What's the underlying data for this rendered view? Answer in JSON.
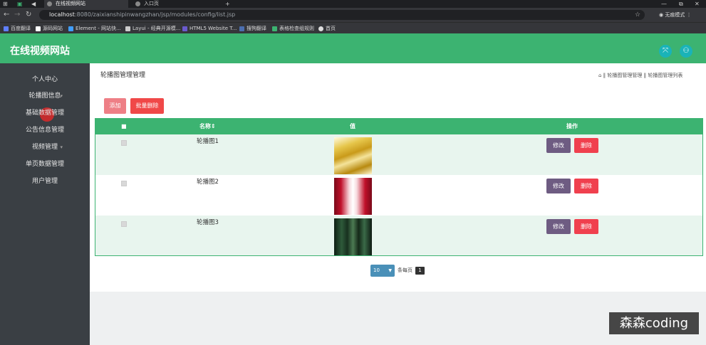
{
  "browser": {
    "tabs": [
      {
        "label": "在线视频网站"
      },
      {
        "label": "入口页"
      }
    ],
    "window_controls": {
      "minimize": "—",
      "restore": "⧉",
      "close": "✕"
    },
    "url_host": "localhost",
    "url_rest": ":8080/zaixianshipinwangzhan/jsp/modules/config/list.jsp",
    "profile_label": "无痕模式",
    "bookmarks": [
      "百度翻译",
      "源码网站",
      "Element - 网站快...",
      "Layui - 经典开源模...",
      "HTML5 Website T...",
      "搜狗翻译",
      "表格检查组规则",
      "首页"
    ]
  },
  "app": {
    "title": "在线视频网站",
    "header_buttons": [
      "fullscreen-icon",
      "user-icon"
    ]
  },
  "sidebar": {
    "items": [
      {
        "label": "个人中心",
        "has_arrow": false
      },
      {
        "label": "轮播图信息",
        "has_arrow": true
      },
      {
        "label": "基础数据管理",
        "has_arrow": true
      },
      {
        "label": "公告信息管理",
        "has_arrow": true
      },
      {
        "label": "视频管理",
        "has_arrow": true
      },
      {
        "label": "单页数据管理",
        "has_arrow": true
      },
      {
        "label": "用户管理",
        "has_arrow": false
      }
    ]
  },
  "page": {
    "heading": "轮播图管理管理",
    "breadcrumb": "⌂ ‖ 轮播图管理管理 ‖ 轮播图管理列表",
    "add_label": "添加",
    "batch_delete_label": "批量删除"
  },
  "table": {
    "headers": {
      "select": "■",
      "name": "名称⇕",
      "value": "值",
      "actions": "操作"
    },
    "rows": [
      {
        "name": "轮播图1",
        "thumb": "yellow-fabric"
      },
      {
        "name": "轮播图2",
        "thumb": "red-curtain"
      },
      {
        "name": "轮播图3",
        "thumb": "green-forest"
      }
    ],
    "edit_label": "修改",
    "delete_label": "删除"
  },
  "pager": {
    "page_size": "10",
    "per_page_label": "条每页",
    "current_page": "1"
  },
  "watermark": "森森coding",
  "colors": {
    "primary": "#3cb371",
    "danger": "#f04848",
    "edit": "#6e5c82",
    "sidebar": "#3a3f44"
  }
}
